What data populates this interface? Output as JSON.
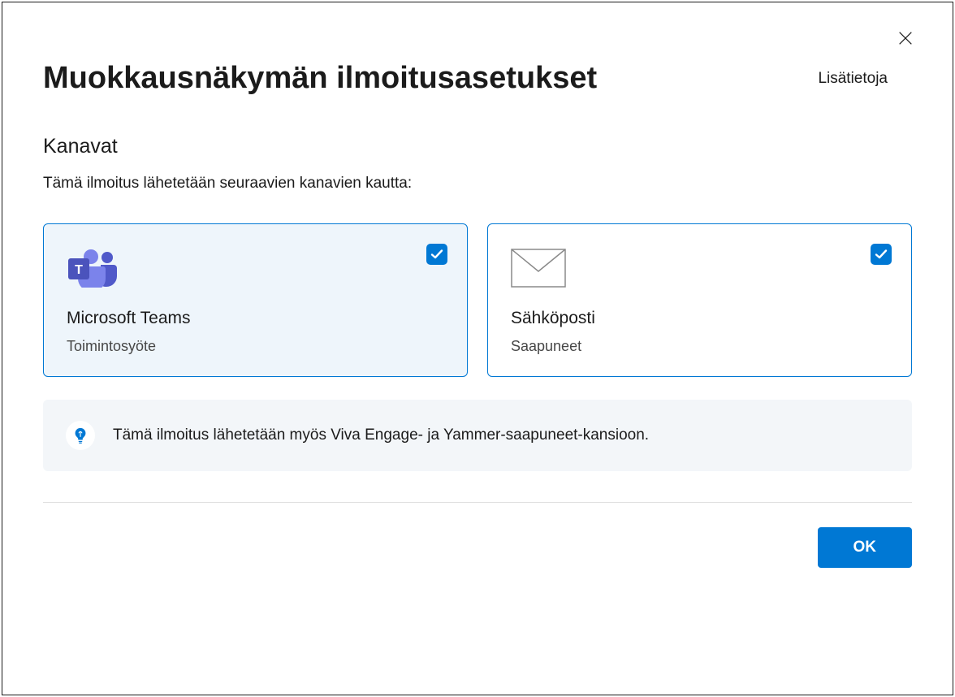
{
  "dialog": {
    "title": "Muokkausnäkymän ilmoitusasetukset",
    "more_info": "Lisätietoja",
    "section_title": "Kanavat",
    "section_desc": "Tämä ilmoitus lähetetään seuraavien kanavien kautta:",
    "channels": [
      {
        "title": "Microsoft Teams",
        "subtitle": "Toimintosyöte",
        "checked": true,
        "icon": "teams"
      },
      {
        "title": "Sähköposti",
        "subtitle": "Saapuneet",
        "checked": true,
        "icon": "envelope"
      }
    ],
    "info_text": "Tämä ilmoitus lähetetään myös Viva Engage- ja Yammer-saapuneet-kansioon.",
    "ok_label": "OK"
  }
}
